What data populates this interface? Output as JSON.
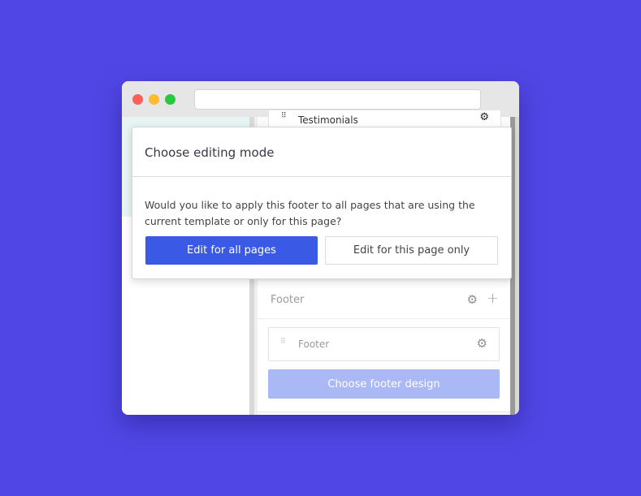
{
  "browser": {
    "url": "",
    "traffic_lights": [
      "close",
      "minimize",
      "maximize"
    ]
  },
  "sidebar": {
    "testimonials_row": {
      "label": "Testimonials",
      "drag_icon": "⠿",
      "gear_icon": "⚙"
    },
    "footer_section": {
      "title": "Footer",
      "gear_icon": "⚙",
      "plus_icon": "+",
      "item": {
        "label": "Footer",
        "drag_icon": "⠿",
        "gear_icon": "⚙"
      },
      "choose_design_label": "Choose footer design"
    }
  },
  "modal": {
    "title": "Choose editing mode",
    "message": "Would you like to apply this footer to all pages that are using the current template or only for this page?",
    "primary_button": "Edit for all pages",
    "secondary_button": "Edit for this page only"
  },
  "colors": {
    "background": "#5046e5",
    "primary": "#3a5ae6",
    "primary_disabled": "#aab8f5"
  }
}
